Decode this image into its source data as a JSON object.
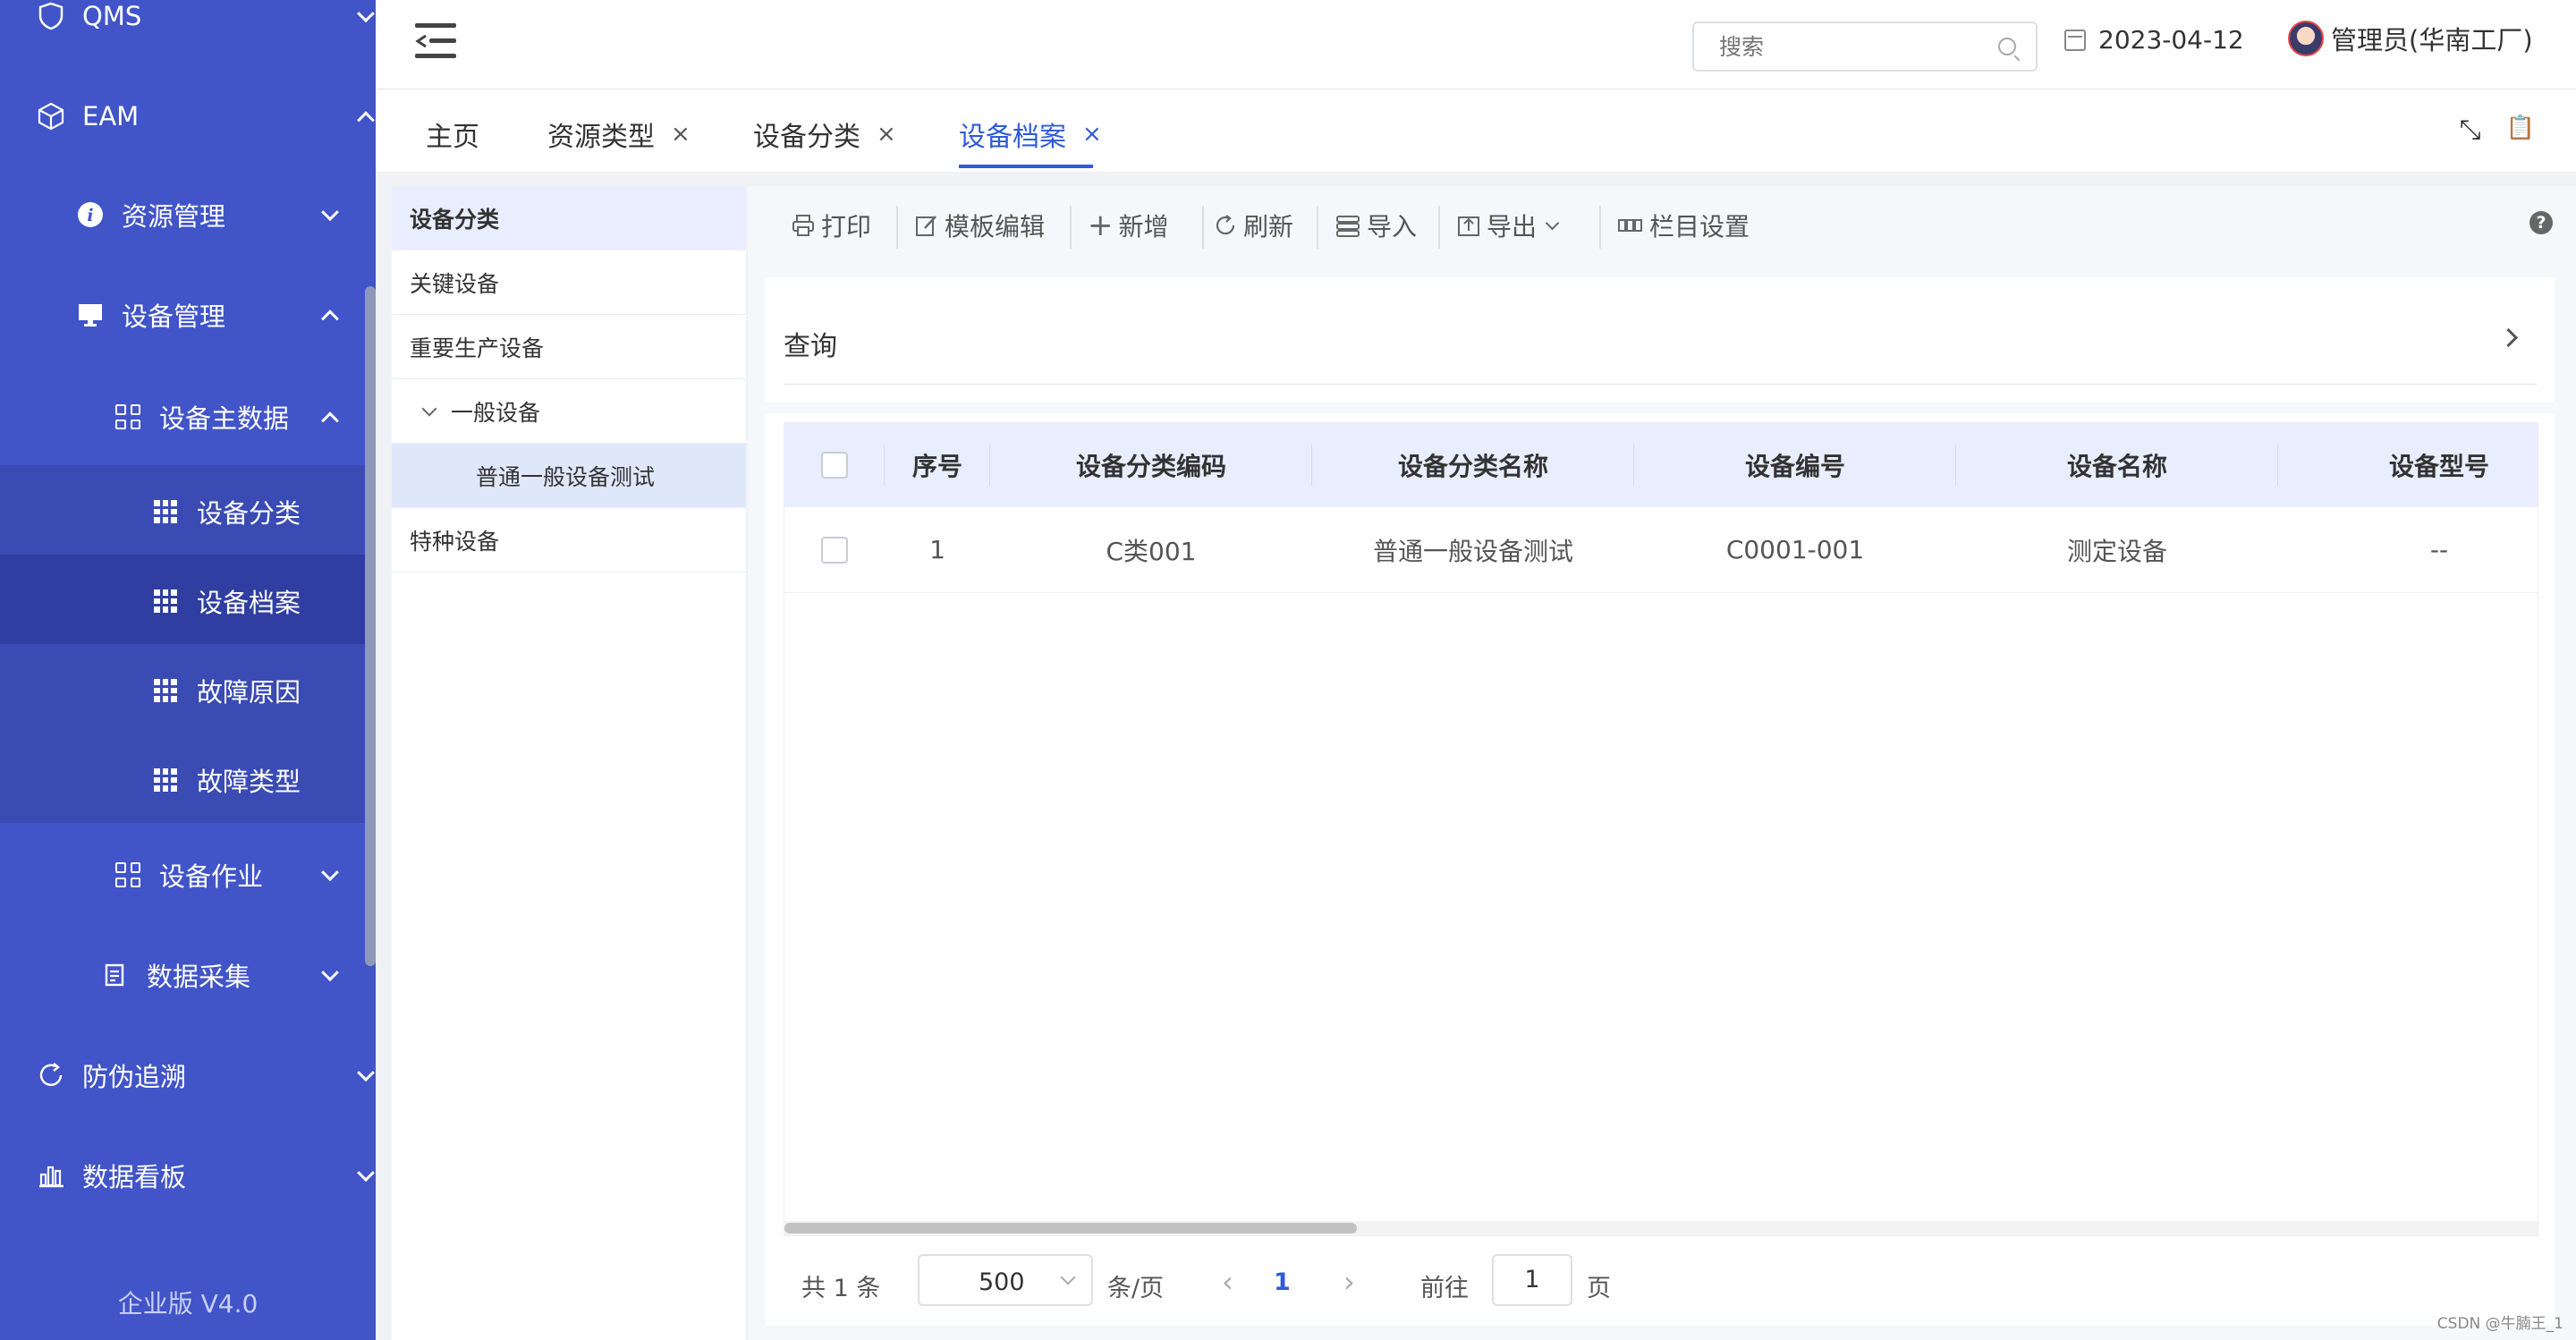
{
  "sidebar": {
    "items": [
      {
        "label": "QMS",
        "icon": "shield-icon"
      },
      {
        "label": "EAM",
        "icon": "cube-icon"
      },
      {
        "label": "资源管理",
        "icon": "info-icon"
      },
      {
        "label": "设备管理",
        "icon": "monitor-icon"
      },
      {
        "label": "设备主数据",
        "icon": "apps-icon"
      },
      {
        "label": "设备分类",
        "icon": "grid-icon"
      },
      {
        "label": "设备档案",
        "icon": "grid-icon"
      },
      {
        "label": "故障原因",
        "icon": "grid-icon"
      },
      {
        "label": "故障类型",
        "icon": "grid-icon"
      },
      {
        "label": "设备作业",
        "icon": "apps-icon"
      },
      {
        "label": "数据采集",
        "icon": "document-icon"
      },
      {
        "label": "防伪追溯",
        "icon": "refresh-icon"
      },
      {
        "label": "数据看板",
        "icon": "bar-chart-icon"
      }
    ],
    "version": "企业版 V4.0"
  },
  "header": {
    "search_placeholder": "搜索",
    "date": "2023-04-12",
    "user": "管理员(华南工厂)"
  },
  "tabs": [
    {
      "label": "主页",
      "closable": false
    },
    {
      "label": "资源类型",
      "closable": true
    },
    {
      "label": "设备分类",
      "closable": true
    },
    {
      "label": "设备档案",
      "closable": true,
      "active": true
    }
  ],
  "tab_close_glyph": "×",
  "tab_tools": {
    "fullscreen": "⤡",
    "clipboard": "📋"
  },
  "categories": {
    "title": "设备分类",
    "items": [
      "关键设备",
      "重要生产设备",
      "一般设备",
      "普通一般设备测试",
      "特种设备"
    ]
  },
  "toolbar": {
    "print": "打印",
    "template_edit": "模板编辑",
    "add": "新增",
    "refresh": "刷新",
    "import": "导入",
    "export": "导出",
    "columns": "栏目设置",
    "help": "?"
  },
  "query": {
    "label": "查询"
  },
  "table": {
    "columns": [
      "序号",
      "设备分类编码",
      "设备分类名称",
      "设备编号",
      "设备名称",
      "设备型号"
    ],
    "rows": [
      [
        "1",
        "C类001",
        "普通一般设备测试",
        "C0001-001",
        "测定设备",
        "--"
      ]
    ]
  },
  "pagination": {
    "total": "共 1 条",
    "page_size": "500",
    "per_page": "条/页",
    "current": "1",
    "goto_label": "前往",
    "goto_value": "1",
    "page_suffix": "页"
  },
  "credit": "CSDN @牛腩王_1",
  "colors": {
    "sidebar_bg": "#4154c8",
    "accent": "#2f5bd8"
  }
}
